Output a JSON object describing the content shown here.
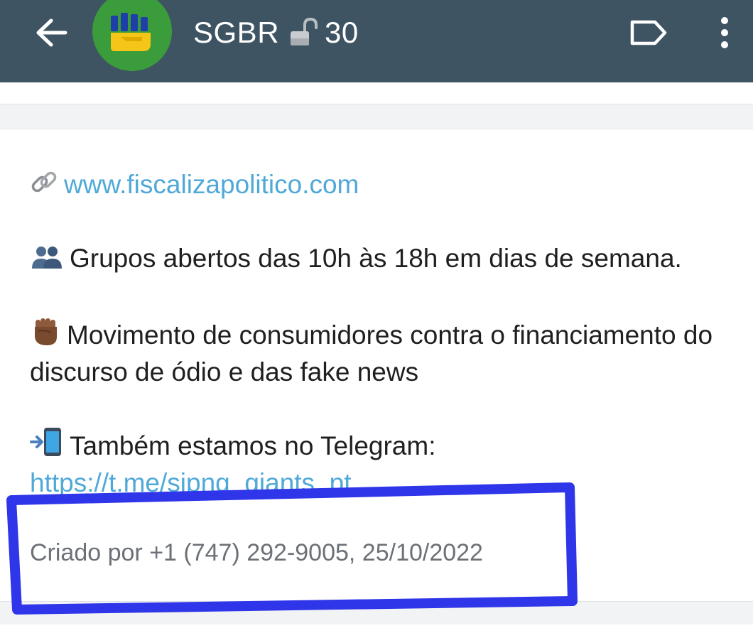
{
  "header": {
    "title": "SGBR",
    "member_count": "30",
    "bar_color": "#3e5463",
    "icons": {
      "back": "arrow-left-icon",
      "lock": "open-lock-icon",
      "label": "label-tag-icon",
      "more": "more-vertical-icon"
    }
  },
  "description": {
    "website_link": "www.fiscalizapolitico.com",
    "schedule_text": "Grupos abertos das 10h às 18h em dias de semana.",
    "movement_text": "Movimento de consumidores contra o financiamento do discurso de ódio e das fake news",
    "telegram_text": "Também estamos no Telegram:",
    "telegram_link": "https://t.me/sipng_giants_pt",
    "link_color": "#4fa9d8"
  },
  "footer": {
    "created_by": "Criado por +1 (747) 292-9005, 25/10/2022"
  },
  "annotation": {
    "color": "#2f35e8"
  }
}
